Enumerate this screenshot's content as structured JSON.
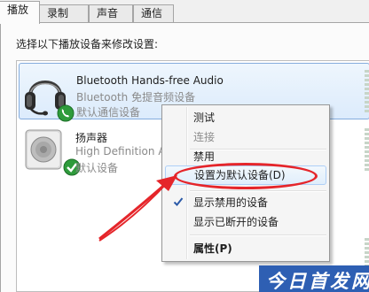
{
  "tabs": [
    {
      "label": "播放",
      "active": true
    },
    {
      "label": "录制",
      "active": false
    },
    {
      "label": "声音",
      "active": false
    },
    {
      "label": "通信",
      "active": false
    }
  ],
  "instruction": "选择以下播放设备来修改设置:",
  "devices": [
    {
      "name": "Bluetooth Hands-free Audio",
      "description": "Bluetooth 免提音频设备",
      "status": "默认通信设备",
      "icon": "headset-icon",
      "badge": "phone-badge-icon",
      "selected": true
    },
    {
      "name": "扬声器",
      "description": "High Definition Audio",
      "status": "默认设备",
      "icon": "speaker-icon",
      "badge": "checkmark-badge-icon",
      "selected": false
    }
  ],
  "context_menu": {
    "items": [
      {
        "label": "测试",
        "disabled": false
      },
      {
        "label": "连接",
        "disabled": true
      },
      {
        "label": "禁用",
        "disabled": false
      },
      {
        "label": "设置为默认设备(D)",
        "disabled": false,
        "highlighted": true
      },
      {
        "label": "显示禁用的设备",
        "checked": true
      },
      {
        "label": "显示已断开的设备",
        "checked": false
      },
      {
        "label": "属性(P)",
        "bold": true
      }
    ]
  },
  "annotation": {
    "color": "#e5252a"
  },
  "watermark": {
    "text": "今日首发网",
    "color": "#2e5fb3"
  }
}
